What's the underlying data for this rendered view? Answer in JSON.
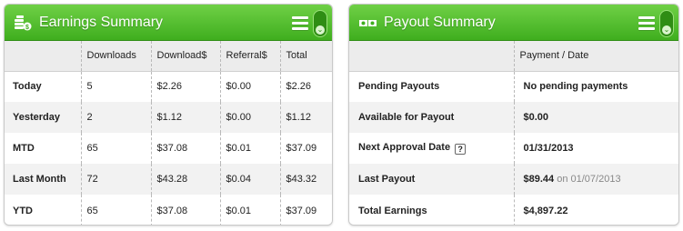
{
  "earnings": {
    "title": "Earnings Summary",
    "columns": [
      "",
      "Downloads",
      "Download$",
      "Referral$",
      "Total"
    ],
    "rows": [
      {
        "label": "Today",
        "downloads": "5",
        "download_amt": "$2.26",
        "referral": "$0.00",
        "total": "$2.26"
      },
      {
        "label": "Yesterday",
        "downloads": "2",
        "download_amt": "$1.12",
        "referral": "$0.00",
        "total": "$1.12"
      },
      {
        "label": "MTD",
        "downloads": "65",
        "download_amt": "$37.08",
        "referral": "$0.01",
        "total": "$37.09"
      },
      {
        "label": "Last Month",
        "downloads": "72",
        "download_amt": "$43.28",
        "referral": "$0.04",
        "total": "$43.32"
      },
      {
        "label": "YTD",
        "downloads": "65",
        "download_amt": "$37.08",
        "referral": "$0.01",
        "total": "$37.09"
      }
    ]
  },
  "payout": {
    "title": "Payout Summary",
    "columns": [
      "",
      "Payment / Date"
    ],
    "rows": [
      {
        "label": "Pending Payouts",
        "value": "No pending payments",
        "date": ""
      },
      {
        "label": "Available for Payout",
        "value": "$0.00",
        "date": ""
      },
      {
        "label": "Next Approval Date",
        "value": "01/31/2013",
        "date": "",
        "help": "?"
      },
      {
        "label": "Last Payout",
        "value": "$89.44",
        "date": "on 01/07/2013"
      },
      {
        "label": "Total Earnings",
        "value": "$4,897.22",
        "date": ""
      }
    ]
  },
  "icons": {
    "earnings": "coin-stack-icon",
    "payout": "money-bills-icon",
    "menu": "hamburger-menu-icon",
    "toggle": "collapse-toggle-icon"
  },
  "colors": {
    "header_green": "#4cbd28",
    "header_border": "#2f8d14"
  }
}
